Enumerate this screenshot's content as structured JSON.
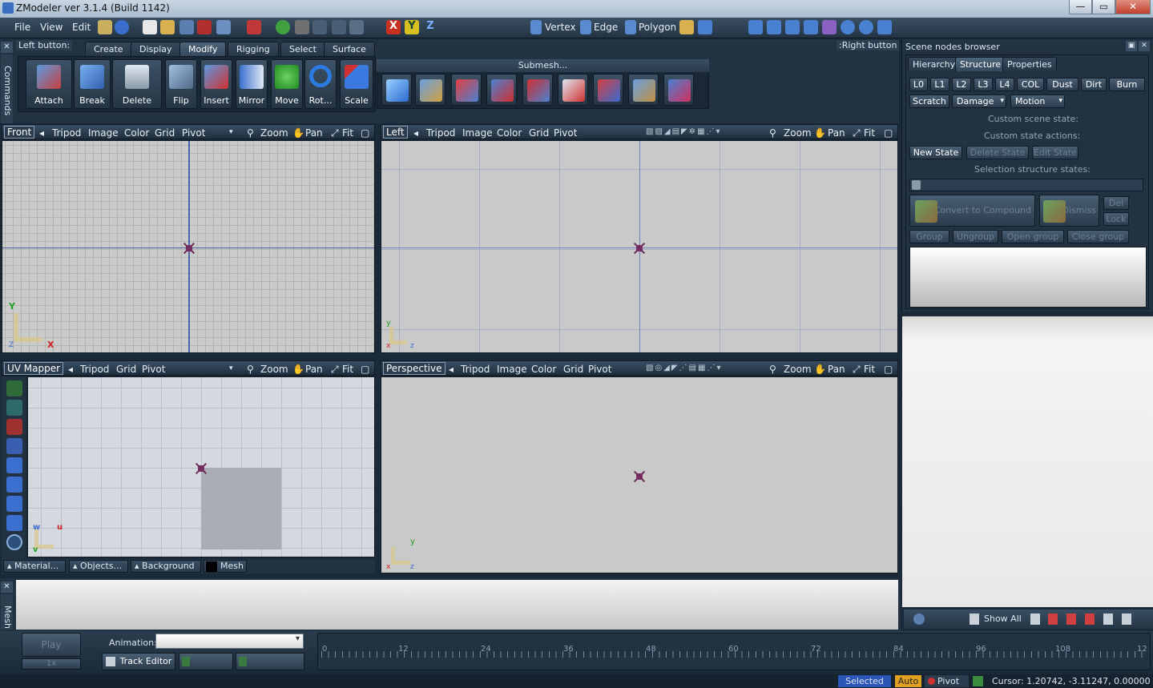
{
  "window": {
    "title": "ZModeler ver 3.1.4 (Build 1142)",
    "min": "—",
    "max": "▭",
    "close": "✕"
  },
  "menu": {
    "file": "File",
    "view": "View",
    "edit": "Edit"
  },
  "toolbar": {
    "axis_x": "X",
    "axis_y": "Y",
    "axis_z": "Z",
    "vertex": "Vertex",
    "edge": "Edge",
    "polygon": "Polygon"
  },
  "commands": {
    "side_label": "Commands",
    "left_button": "Left button:",
    "right_button": ":Right button",
    "tabs": [
      "Create",
      "Display",
      "Modify",
      "Rigging",
      "Select",
      "Surface"
    ],
    "active_tab": "Modify",
    "buttons": [
      "Attach",
      "Break",
      "Delete",
      "Flip",
      "Insert",
      "Mirror",
      "Move",
      "Rot...",
      "Scale"
    ],
    "submesh": "Submesh..."
  },
  "viewports": {
    "front": {
      "name": "Front",
      "items": [
        "Tripod",
        "Image",
        "Color",
        "Grid",
        "Pivot"
      ],
      "zoom": "Zoom",
      "pan": "Pan",
      "fit": "Fit",
      "ax1": "Y",
      "ax2": "X",
      "ax3": "Z"
    },
    "left": {
      "name": "Left",
      "items": [
        "Tripod",
        "Image",
        "Color",
        "Grid",
        "Pivot"
      ],
      "zoom": "Zoom",
      "pan": "Pan",
      "fit": "Fit",
      "ax1": "y",
      "ax2": "x",
      "ax3": "z"
    },
    "uv": {
      "name": "UV Mapper",
      "items": [
        "Tripod",
        "Grid",
        "Pivot"
      ],
      "zoom": "Zoom",
      "pan": "Pan",
      "fit": "Fit",
      "ax1": "w",
      "ax2": "u",
      "ax3": "v"
    },
    "persp": {
      "name": "Perspective",
      "items": [
        "Tripod",
        "Image",
        "Color",
        "Grid",
        "Pivot"
      ],
      "zoom": "Zoom",
      "pan": "Pan",
      "fit": "Fit",
      "ax1": "y",
      "ax2": "x",
      "ax3": "z"
    }
  },
  "uv_bottom": {
    "material": "Material...",
    "objects": "Objects...",
    "background": "Background",
    "mesh": "Mesh"
  },
  "scene": {
    "title": "Scene nodes browser",
    "tabs": [
      "Hierarchy",
      "Structure",
      "Properties"
    ],
    "active_tab": "Structure",
    "levels": [
      "L0",
      "L1",
      "L2",
      "L3",
      "L4",
      "COL",
      "Dust",
      "Dirt",
      "Burn"
    ],
    "scratch": "Scratch",
    "damage": "Damage",
    "motion": "Motion",
    "custom_scene_state": "Custom scene state:",
    "custom_state_actions": "Custom state actions:",
    "new_state": "New State",
    "delete_state": "Delete State",
    "edit_state": "Edit State",
    "selection_states": "Selection structure states:",
    "convert": "Convert to Compound",
    "dismiss": "Dismiss",
    "del": "Del",
    "lock": "Lock",
    "group": "Group",
    "ungroup": "Ungroup",
    "open_group": "Open group",
    "close_group": "Close group",
    "show_all": "Show All"
  },
  "mesh_side": "Mesh",
  "anim": {
    "play": "Play",
    "speed": "1x",
    "animation_label": "Animation:",
    "track_editor": "Track Editor",
    "ticks": [
      "0",
      "12",
      "24",
      "36",
      "48",
      "60",
      "72",
      "84",
      "96",
      "108",
      "12"
    ]
  },
  "status": {
    "selected": "Selected",
    "auto": "Auto",
    "pivot": "Pivot",
    "cursor": "Cursor: 1.20742, -3.11247, 0.00000"
  }
}
